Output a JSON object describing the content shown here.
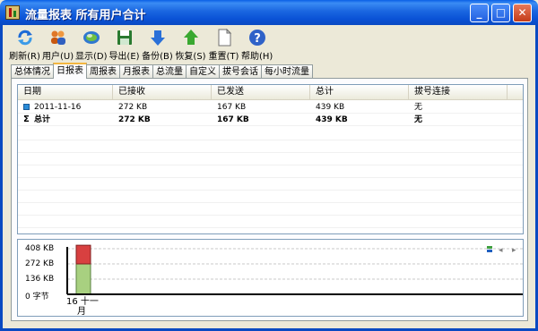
{
  "window": {
    "title": "流量报表  所有用户合计",
    "minimize": "_",
    "maximize": "□",
    "close": "✕"
  },
  "toolbar": [
    {
      "label": "刷新(R)",
      "icon": "refresh-icon"
    },
    {
      "label": "用户(U)",
      "icon": "users-icon"
    },
    {
      "label": "显示(D)",
      "icon": "display-icon"
    },
    {
      "label": "导出(E)",
      "icon": "export-disk-icon"
    },
    {
      "label": "备份(B)",
      "icon": "backup-arrow-icon"
    },
    {
      "label": "恢复(S)",
      "icon": "restore-arrow-icon"
    },
    {
      "label": "重置(T)",
      "icon": "reset-page-icon"
    },
    {
      "label": "帮助(H)",
      "icon": "help-icon"
    }
  ],
  "tabs": [
    "总体情况",
    "日报表",
    "周报表",
    "月报表",
    "总流量",
    "自定义",
    "拔号会话",
    "每小时流量"
  ],
  "active_tab": "日报表",
  "table": {
    "columns": [
      "日期",
      "已接收",
      "已发送",
      "总计",
      "拔号连接"
    ],
    "rows": [
      {
        "date": "2011-11-16",
        "received": "272 KB",
        "sent": "167 KB",
        "total": "439 KB",
        "dialup": "无"
      }
    ],
    "total_row": {
      "label": "总计",
      "received": "272 KB",
      "sent": "167 KB",
      "total": "439 KB",
      "dialup": "无"
    }
  },
  "chart_data": {
    "type": "bar",
    "categories": [
      "16 十一月"
    ],
    "x_label_lines": [
      "16 十一",
      "月"
    ],
    "series": [
      {
        "values": [
          272
        ],
        "color": "#a8d080"
      },
      {
        "values": [
          167
        ],
        "color": "#d84040"
      }
    ],
    "stacked": true,
    "yticks": [
      "408 KB",
      "272 KB",
      "136 KB",
      "0 字节"
    ],
    "ylim": [
      0,
      408
    ],
    "unit": "KB"
  },
  "chart_controls": {
    "prev": "◂",
    "next": "▸"
  }
}
